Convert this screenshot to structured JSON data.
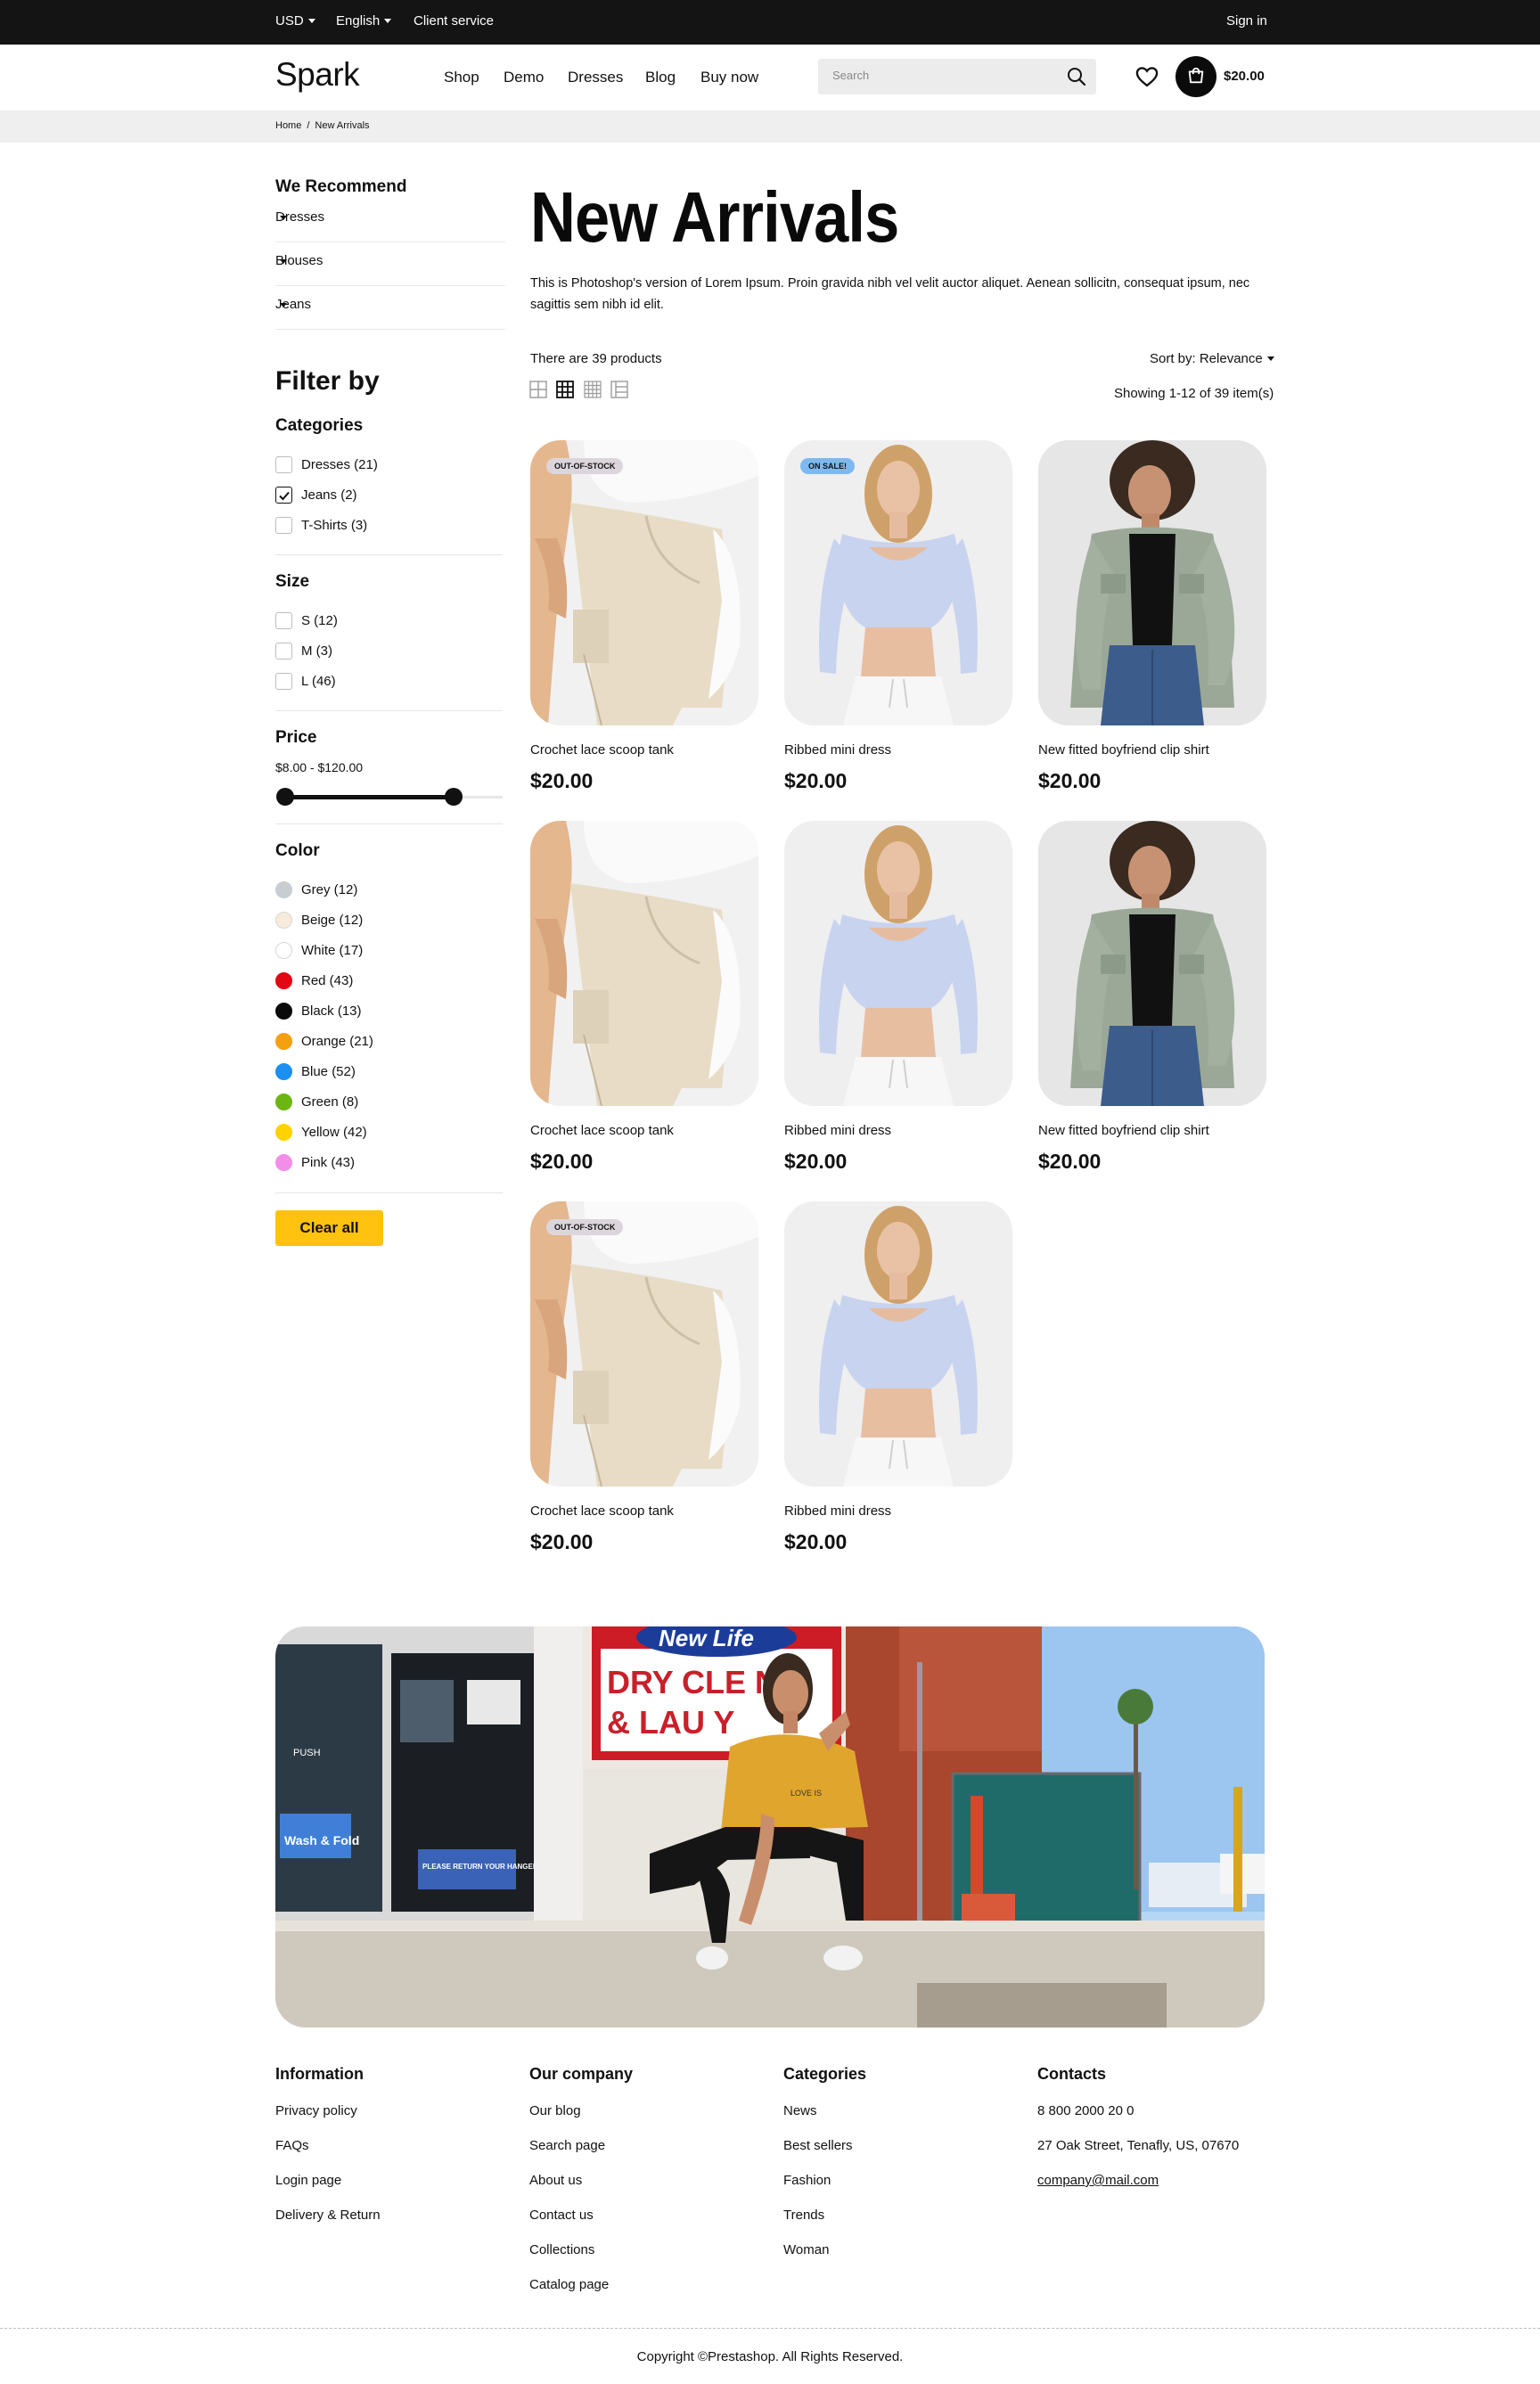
{
  "topbar": {
    "currency": "USD",
    "language": "English",
    "client_service": "Client service",
    "sign_in": "Sign in"
  },
  "header": {
    "logo": "Spark",
    "nav": [
      "Shop",
      "Demo",
      "Dresses",
      "Blog",
      "Buy now"
    ],
    "search_placeholder": "Search",
    "cart_total": "$20.00",
    "icons": [
      "search-icon",
      "heart-icon",
      "cart-icon"
    ]
  },
  "breadcrumb": {
    "home": "Home",
    "sep": "/",
    "current": "New Arrivals"
  },
  "sidebar": {
    "recommend_title": "We Recommend",
    "recommend": [
      "Dresses",
      "Blouses",
      "Jeans"
    ],
    "filter_title": "Filter by",
    "categories_title": "Categories",
    "categories": [
      {
        "label": "Dresses (21)",
        "checked": false
      },
      {
        "label": "Jeans (2)",
        "checked": true
      },
      {
        "label": "T-Shirts (3)",
        "checked": false
      }
    ],
    "size_title": "Size",
    "sizes": [
      "S (12)",
      "M (3)",
      "L (46)"
    ],
    "price_title": "Price",
    "price_range": "$8.00 - $120.00",
    "price_slider": {
      "min": 8,
      "max": 120
    },
    "color_title": "Color",
    "colors": [
      {
        "label": "Grey (12)",
        "hex": "#c7cdd1"
      },
      {
        "label": "Beige (12)",
        "hex": "#f7ecdc"
      },
      {
        "label": "White (17)",
        "hex": "#ffffff"
      },
      {
        "label": "Red (43)",
        "hex": "#e30613"
      },
      {
        "label": "Black (13)",
        "hex": "#0a0a0a"
      },
      {
        "label": "Orange (21)",
        "hex": "#f5a00f"
      },
      {
        "label": "Blue (52)",
        "hex": "#1b90f0"
      },
      {
        "label": "Green (8)",
        "hex": "#6cb513"
      },
      {
        "label": "Yellow (42)",
        "hex": "#ffd200"
      },
      {
        "label": "Pink (43)",
        "hex": "#f28ee8"
      }
    ],
    "clear_all": "Clear all"
  },
  "main": {
    "title": "New Arrivals",
    "description": "This is Photoshop's version of Lorem Ipsum. Proin gravida nibh vel velit auctor aliquet. Aenean sollicitn, consequat ipsum, nec sagittis sem nibh id elit.",
    "product_count": "There are 39 products",
    "sort": "Sort by: Relevance",
    "showing": "Showing 1-12 of 39 item(s)",
    "view_modes": [
      "grid-2-icon",
      "grid-3-icon",
      "grid-4-icon",
      "list-icon"
    ],
    "products": [
      {
        "name": "Crochet lace scoop tank",
        "price": "$20.00",
        "badge": "OUT-OF-STOCK",
        "image": "shorts"
      },
      {
        "name": "Ribbed mini dress",
        "price": "$20.00",
        "badge": "ON SALE!",
        "image": "croptop"
      },
      {
        "name": "New fitted boyfriend clip shirt",
        "price": "$20.00",
        "badge": "",
        "image": "jacket"
      },
      {
        "name": "Crochet lace scoop tank",
        "price": "$20.00",
        "badge": "",
        "image": "shorts"
      },
      {
        "name": "Ribbed mini dress",
        "price": "$20.00",
        "badge": "",
        "image": "croptop"
      },
      {
        "name": "New fitted boyfriend clip shirt",
        "price": "$20.00",
        "badge": "",
        "image": "jacket"
      },
      {
        "name": "Crochet lace scoop tank",
        "price": "$20.00",
        "badge": "OUT-OF-STOCK",
        "image": "shorts"
      },
      {
        "name": "Ribbed mini dress",
        "price": "$20.00",
        "badge": "",
        "image": "croptop"
      }
    ]
  },
  "banner": {
    "sign_top": "New Life",
    "sign_line1": "DRY CLE  NG",
    "sign_line2": "& LAU    Y",
    "shirt_text": "LOVE IS",
    "window_text": "Wash & Fold",
    "notice_text": "PLEASE RETURN YOUR HANGERS",
    "push_text": "PUSH"
  },
  "footer": {
    "columns": [
      {
        "title": "Information",
        "links": [
          "Privacy policy",
          "FAQs",
          "Login page",
          "Delivery & Return"
        ]
      },
      {
        "title": "Our company",
        "links": [
          "Our blog",
          "Search page",
          "About us",
          "Contact us",
          "Collections",
          "Catalog page"
        ]
      },
      {
        "title": "Categories",
        "links": [
          "News",
          "Best sellers",
          "Fashion",
          "Trends",
          "Woman"
        ]
      },
      {
        "title": "Contacts",
        "links": [
          "8 800 2000 20 0",
          "27 Oak Street, Tenafly, US, 07670",
          "company@mail.com"
        ]
      }
    ],
    "copyright": "Copyright ©Prestashop. All Rights Reserved."
  }
}
